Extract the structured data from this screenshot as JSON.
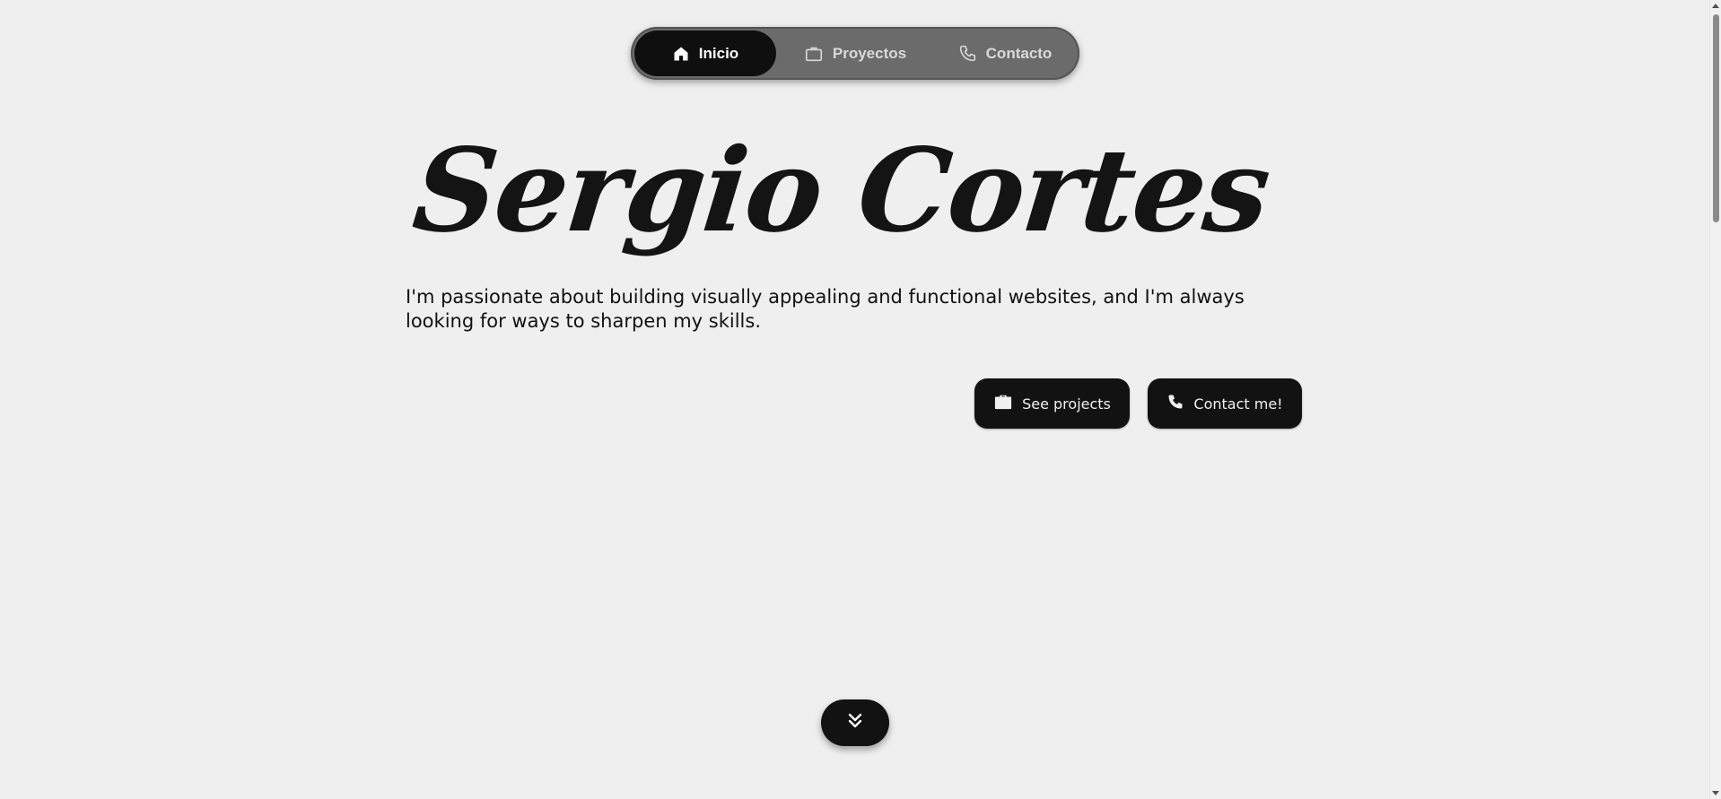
{
  "nav": {
    "items": [
      {
        "label": "Inicio",
        "icon": "home-icon",
        "active": true
      },
      {
        "label": "Proyectos",
        "icon": "briefcase-icon",
        "active": false
      },
      {
        "label": "Contacto",
        "icon": "phone-icon",
        "active": false
      }
    ]
  },
  "hero": {
    "name": "Sergio Cortes",
    "description": "I'm passionate about building visually appealing and functional websites, and I'm always looking for ways to sharpen my skills."
  },
  "actions": {
    "see_projects_label": "See projects",
    "contact_label": "Contact me!"
  },
  "scroll_button": {
    "icon": "double-chevron-down-icon"
  },
  "colors": {
    "background": "#efefef",
    "button": "#121212",
    "nav_pill": "#6b6b6b",
    "text": "#141414"
  }
}
